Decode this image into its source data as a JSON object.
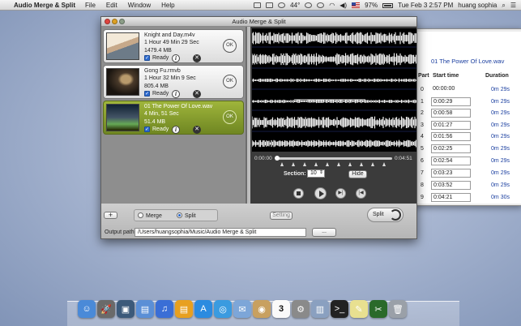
{
  "menubar": {
    "app": "Audio Merge & Split",
    "items": [
      "File",
      "Edit",
      "Window",
      "Help"
    ],
    "volume_pct": "44°",
    "battery": "97%",
    "datetime": "Tue Feb 3  2:57 PM",
    "user": "huang sophia"
  },
  "window": {
    "title": "Audio Merge & Split"
  },
  "files": [
    {
      "name": "Knight and Day.m4v",
      "duration": "1 Hour 49 Min 29 Sec",
      "size": "1479.4 MB",
      "status": "Ready",
      "ok": "OK",
      "selected": false
    },
    {
      "name": "Gong Fu.rmvb",
      "duration": "1 Hour 32 Min 9 Sec",
      "size": "805.4 MB",
      "status": "Ready",
      "ok": "OK",
      "selected": false
    },
    {
      "name": "01 The Power Of Love.wav",
      "duration": "4 Min, 51 Sec",
      "size": "51.4 MB",
      "status": "Ready",
      "ok": "OK",
      "selected": true
    }
  ],
  "timeline": {
    "start": "0:00:00",
    "end": "0:04:51",
    "section_label": "Section:",
    "section_value": "10",
    "hide_label": "Hide"
  },
  "bottom": {
    "add": "+",
    "merge": "Merge",
    "split": "Split",
    "mode": "Split",
    "setting": "Setting",
    "output_label": "Output path:",
    "output_path": "/Users/huangsophia/Music/Audio Merge & Split",
    "browse": "...",
    "split_button": "Split"
  },
  "split_panel": {
    "song": "01 The Power Of Love.wav",
    "headers": {
      "part": "Part",
      "start": "Start time",
      "duration": "Duration"
    },
    "rows": [
      {
        "part": "0",
        "start": "00:00:00",
        "duration": "0m 29s",
        "editable": false
      },
      {
        "part": "1",
        "start": "0:00:29",
        "duration": "0m 29s",
        "editable": true
      },
      {
        "part": "2",
        "start": "0:00:58",
        "duration": "0m 29s",
        "editable": true
      },
      {
        "part": "3",
        "start": "0:01:27",
        "duration": "0m 29s",
        "editable": true
      },
      {
        "part": "4",
        "start": "0:01:56",
        "duration": "0m 29s",
        "editable": true
      },
      {
        "part": "5",
        "start": "0:02:25",
        "duration": "0m 29s",
        "editable": true
      },
      {
        "part": "6",
        "start": "0:02:54",
        "duration": "0m 29s",
        "editable": true
      },
      {
        "part": "7",
        "start": "0:03:23",
        "duration": "0m 29s",
        "editable": true
      },
      {
        "part": "8",
        "start": "0:03:52",
        "duration": "0m 29s",
        "editable": true
      },
      {
        "part": "9",
        "start": "0:04:21",
        "duration": "0m 30s",
        "editable": true
      }
    ]
  },
  "dock": [
    "finder-icon",
    "launchpad-icon",
    "photo-icon",
    "folder-icon",
    "itunes-icon",
    "books-icon",
    "appstore-icon",
    "safari-icon",
    "mail-icon",
    "contacts-icon",
    "calendar-icon",
    "preferences-icon",
    "preview-icon",
    "terminal-icon",
    "notes-icon",
    "audio-merge-icon",
    "trash-icon"
  ],
  "dock_date": "3"
}
